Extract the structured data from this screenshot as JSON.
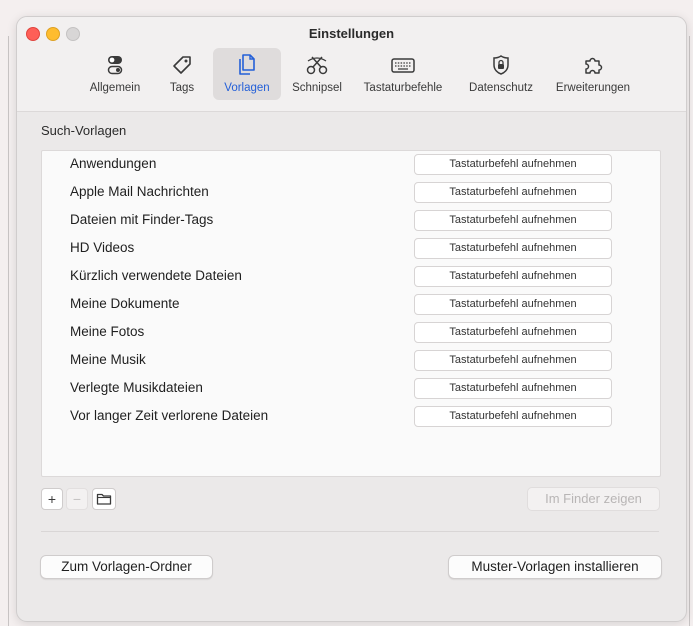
{
  "window": {
    "title": "Einstellungen",
    "traffic_lights": [
      "close",
      "minimize",
      "zoom"
    ]
  },
  "tabs": [
    {
      "label": "Allgemein",
      "icon": "toggles-icon",
      "active": false
    },
    {
      "label": "Tags",
      "icon": "tag-icon",
      "active": false
    },
    {
      "label": "Vorlagen",
      "icon": "documents-icon",
      "active": true
    },
    {
      "label": "Schnipsel",
      "icon": "snippet-icon",
      "active": false
    },
    {
      "label": "Tastaturbefehle",
      "icon": "keyboard-icon",
      "active": false
    },
    {
      "label": "Datenschutz",
      "icon": "lock-shield-icon",
      "active": false
    },
    {
      "label": "Erweiterungen",
      "icon": "puzzle-icon",
      "active": false
    }
  ],
  "section": {
    "title": "Such-Vorlagen"
  },
  "templates": [
    {
      "name": "Anwendungen",
      "shortcut": "Tastaturbefehl aufnehmen"
    },
    {
      "name": "Apple Mail Nachrichten",
      "shortcut": "Tastaturbefehl aufnehmen"
    },
    {
      "name": "Dateien mit Finder-Tags",
      "shortcut": "Tastaturbefehl aufnehmen"
    },
    {
      "name": "HD Videos",
      "shortcut": "Tastaturbefehl aufnehmen"
    },
    {
      "name": "Kürzlich verwendete Dateien",
      "shortcut": "Tastaturbefehl aufnehmen"
    },
    {
      "name": "Meine Dokumente",
      "shortcut": "Tastaturbefehl aufnehmen"
    },
    {
      "name": "Meine Fotos",
      "shortcut": "Tastaturbefehl aufnehmen"
    },
    {
      "name": "Meine Musik",
      "shortcut": "Tastaturbefehl aufnehmen"
    },
    {
      "name": "Verlegte Musikdateien",
      "shortcut": "Tastaturbefehl aufnehmen"
    },
    {
      "name": "Vor langer Zeit verlorene Dateien",
      "shortcut": "Tastaturbefehl aufnehmen"
    }
  ],
  "list_controls": {
    "add": "+",
    "remove": "−",
    "folder_icon": "folder-icon"
  },
  "buttons": {
    "show_in_finder": "Im Finder zeigen",
    "open_templates_folder": "Zum Vorlagen-Ordner",
    "install_samples": "Muster-Vorlagen installieren"
  },
  "colors": {
    "accent": "#2460d8",
    "close": "#fe5f57",
    "minimize": "#febc2e"
  }
}
